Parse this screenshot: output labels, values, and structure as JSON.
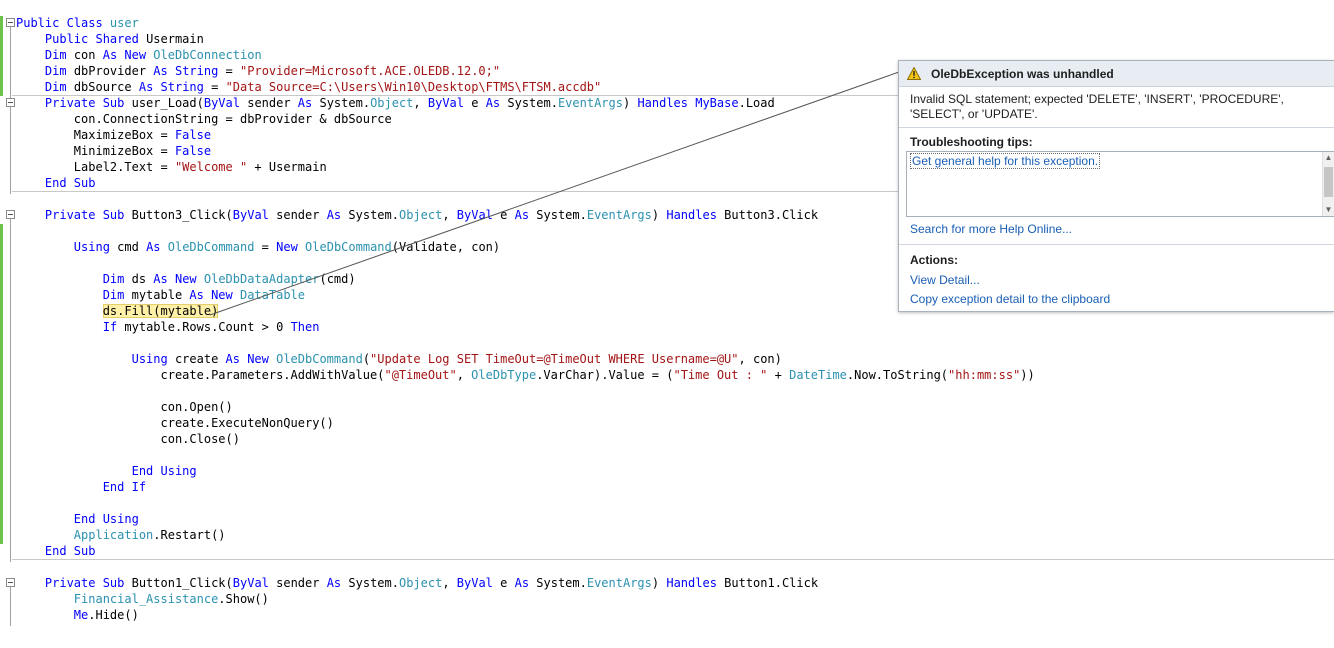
{
  "code": {
    "lines": [
      [
        {
          "t": "Public Class ",
          "c": "kw"
        },
        {
          "t": "user",
          "c": "ty"
        }
      ],
      [
        {
          "t": "    "
        },
        {
          "t": "Public Shared ",
          "c": "kw"
        },
        {
          "t": "Usermain"
        }
      ],
      [
        {
          "t": "    "
        },
        {
          "t": "Dim ",
          "c": "kw"
        },
        {
          "t": "con "
        },
        {
          "t": "As New ",
          "c": "kw"
        },
        {
          "t": "OleDbConnection",
          "c": "ty"
        }
      ],
      [
        {
          "t": "    "
        },
        {
          "t": "Dim ",
          "c": "kw"
        },
        {
          "t": "dbProvider "
        },
        {
          "t": "As String",
          "c": "kw"
        },
        {
          "t": " = "
        },
        {
          "t": "\"Provider=Microsoft.ACE.OLEDB.12.0;\"",
          "c": "st"
        }
      ],
      [
        {
          "t": "    "
        },
        {
          "t": "Dim ",
          "c": "kw"
        },
        {
          "t": "dbSource "
        },
        {
          "t": "As String",
          "c": "kw"
        },
        {
          "t": " = "
        },
        {
          "t": "\"Data Source=C:\\Users\\Win10\\Desktop\\FTMS\\FTSM.accdb\"",
          "c": "st"
        }
      ],
      [
        {
          "t": "    "
        },
        {
          "t": "Private Sub ",
          "c": "kw"
        },
        {
          "t": "user_Load("
        },
        {
          "t": "ByVal ",
          "c": "kw"
        },
        {
          "t": "sender "
        },
        {
          "t": "As ",
          "c": "kw"
        },
        {
          "t": "System."
        },
        {
          "t": "Object",
          "c": "ty"
        },
        {
          "t": ", "
        },
        {
          "t": "ByVal ",
          "c": "kw"
        },
        {
          "t": "e "
        },
        {
          "t": "As ",
          "c": "kw"
        },
        {
          "t": "System."
        },
        {
          "t": "EventArgs",
          "c": "ty"
        },
        {
          "t": ") "
        },
        {
          "t": "Handles ",
          "c": "kw"
        },
        {
          "t": "MyBase",
          "c": "kw"
        },
        {
          "t": ".Load"
        }
      ],
      [
        {
          "t": "        con.ConnectionString = dbProvider & dbSource"
        }
      ],
      [
        {
          "t": "        MaximizeBox = "
        },
        {
          "t": "False",
          "c": "kw"
        }
      ],
      [
        {
          "t": "        MinimizeBox = "
        },
        {
          "t": "False",
          "c": "kw"
        }
      ],
      [
        {
          "t": "        Label2.Text = "
        },
        {
          "t": "\"Welcome \"",
          "c": "st"
        },
        {
          "t": " + Usermain"
        }
      ],
      [
        {
          "t": "    "
        },
        {
          "t": "End Sub",
          "c": "kw"
        }
      ],
      [],
      [
        {
          "t": "    "
        },
        {
          "t": "Private Sub ",
          "c": "kw"
        },
        {
          "t": "Button3_Click("
        },
        {
          "t": "ByVal ",
          "c": "kw"
        },
        {
          "t": "sender "
        },
        {
          "t": "As ",
          "c": "kw"
        },
        {
          "t": "System."
        },
        {
          "t": "Object",
          "c": "ty"
        },
        {
          "t": ", "
        },
        {
          "t": "ByVal ",
          "c": "kw"
        },
        {
          "t": "e "
        },
        {
          "t": "As ",
          "c": "kw"
        },
        {
          "t": "System."
        },
        {
          "t": "EventArgs",
          "c": "ty"
        },
        {
          "t": ") "
        },
        {
          "t": "Handles ",
          "c": "kw"
        },
        {
          "t": "Button3.Click"
        }
      ],
      [],
      [
        {
          "t": "        "
        },
        {
          "t": "Using ",
          "c": "kw"
        },
        {
          "t": "cmd "
        },
        {
          "t": "As ",
          "c": "kw"
        },
        {
          "t": "OleDbCommand",
          "c": "ty"
        },
        {
          "t": " = "
        },
        {
          "t": "New ",
          "c": "kw"
        },
        {
          "t": "OleDbCommand",
          "c": "ty"
        },
        {
          "t": "(Validate, con)"
        }
      ],
      [],
      [
        {
          "t": "            "
        },
        {
          "t": "Dim ",
          "c": "kw"
        },
        {
          "t": "ds "
        },
        {
          "t": "As New ",
          "c": "kw"
        },
        {
          "t": "OleDbDataAdapter",
          "c": "ty"
        },
        {
          "t": "(cmd)"
        }
      ],
      [
        {
          "t": "            "
        },
        {
          "t": "Dim ",
          "c": "kw"
        },
        {
          "t": "mytable "
        },
        {
          "t": "As New ",
          "c": "kw"
        },
        {
          "t": "DataTable",
          "c": "ty"
        }
      ],
      [
        {
          "t": "            "
        },
        {
          "t": "ds.Fill(mytable)",
          "c": "hl"
        }
      ],
      [
        {
          "t": "            "
        },
        {
          "t": "If ",
          "c": "kw"
        },
        {
          "t": "mytable.Rows.Count > 0 "
        },
        {
          "t": "Then",
          "c": "kw"
        }
      ],
      [],
      [
        {
          "t": "                "
        },
        {
          "t": "Using ",
          "c": "kw"
        },
        {
          "t": "create "
        },
        {
          "t": "As New ",
          "c": "kw"
        },
        {
          "t": "OleDbCommand",
          "c": "ty"
        },
        {
          "t": "("
        },
        {
          "t": "\"Update Log SET TimeOut=@TimeOut WHERE Username=@U\"",
          "c": "st"
        },
        {
          "t": ", con)"
        }
      ],
      [
        {
          "t": "                    create.Parameters.AddWithValue("
        },
        {
          "t": "\"@TimeOut\"",
          "c": "st"
        },
        {
          "t": ", "
        },
        {
          "t": "OleDbType",
          "c": "ty"
        },
        {
          "t": ".VarChar).Value = ("
        },
        {
          "t": "\"Time Out : \"",
          "c": "st"
        },
        {
          "t": " + "
        },
        {
          "t": "DateTime",
          "c": "ty"
        },
        {
          "t": ".Now.ToString("
        },
        {
          "t": "\"hh:mm:ss\"",
          "c": "st"
        },
        {
          "t": "))"
        }
      ],
      [],
      [
        {
          "t": "                    con.Open()"
        }
      ],
      [
        {
          "t": "                    create.ExecuteNonQuery()"
        }
      ],
      [
        {
          "t": "                    con.Close()"
        }
      ],
      [],
      [
        {
          "t": "                "
        },
        {
          "t": "End Using",
          "c": "kw"
        }
      ],
      [
        {
          "t": "            "
        },
        {
          "t": "End If",
          "c": "kw"
        }
      ],
      [],
      [
        {
          "t": "        "
        },
        {
          "t": "End Using",
          "c": "kw"
        }
      ],
      [
        {
          "t": "        "
        },
        {
          "t": "Application",
          "c": "ty"
        },
        {
          "t": ".Restart()"
        }
      ],
      [
        {
          "t": "    "
        },
        {
          "t": "End Sub",
          "c": "kw"
        }
      ],
      [],
      [
        {
          "t": "    "
        },
        {
          "t": "Private Sub ",
          "c": "kw"
        },
        {
          "t": "Button1_Click("
        },
        {
          "t": "ByVal ",
          "c": "kw"
        },
        {
          "t": "sender "
        },
        {
          "t": "As ",
          "c": "kw"
        },
        {
          "t": "System."
        },
        {
          "t": "Object",
          "c": "ty"
        },
        {
          "t": ", "
        },
        {
          "t": "ByVal ",
          "c": "kw"
        },
        {
          "t": "e "
        },
        {
          "t": "As ",
          "c": "kw"
        },
        {
          "t": "System."
        },
        {
          "t": "EventArgs",
          "c": "ty"
        },
        {
          "t": ") "
        },
        {
          "t": "Handles ",
          "c": "kw"
        },
        {
          "t": "Button1.Click"
        }
      ],
      [
        {
          "t": "        "
        },
        {
          "t": "Financial_Assistance",
          "c": "ty"
        },
        {
          "t": ".Show()"
        }
      ],
      [
        {
          "t": "        "
        },
        {
          "t": "Me",
          "c": "kw"
        },
        {
          "t": ".Hide()"
        }
      ]
    ],
    "colors": {
      "keyword": "#0000ff",
      "type": "#2b91af",
      "string": "#a31515",
      "highlight": "#fff2a8"
    }
  },
  "exception": {
    "icon": "warning-icon",
    "title": "OleDbException was unhandled",
    "message": "Invalid SQL statement; expected 'DELETE', 'INSERT', 'PROCEDURE', 'SELECT', or 'UPDATE'.",
    "tips_heading": "Troubleshooting tips:",
    "tips": [
      "Get general help for this exception."
    ],
    "search_link": "Search for more Help Online...",
    "actions_heading": "Actions:",
    "actions": [
      "View Detail...",
      "Copy exception detail to the clipboard"
    ]
  }
}
